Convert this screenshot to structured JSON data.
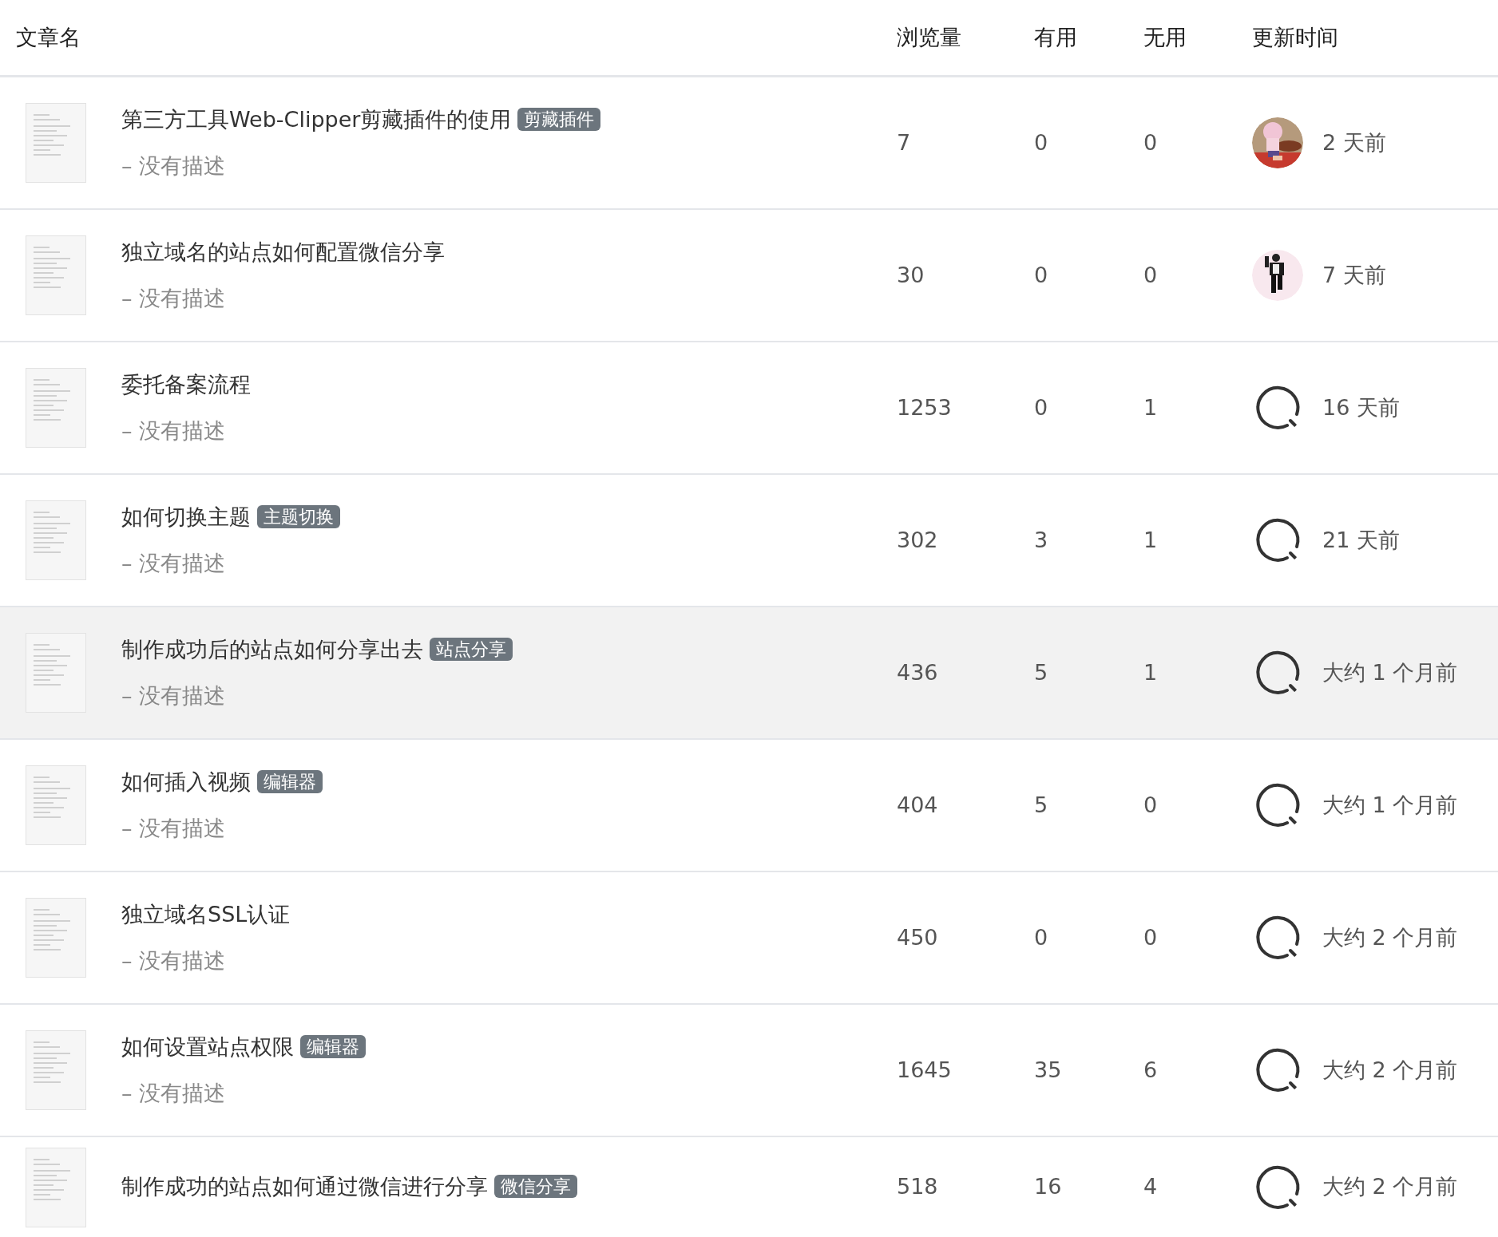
{
  "table": {
    "columns": [
      "文章名",
      "浏览量",
      "有用",
      "无用",
      "更新时间"
    ],
    "rows": [
      {
        "title": "第三方工具Web-Clipper剪藏插件的使用",
        "tag": "剪藏插件",
        "description": "– 没有描述",
        "views": "7",
        "useful": "0",
        "useless": "0",
        "updated": "2 天前",
        "hovered": false
      },
      {
        "title": "独立域名的站点如何配置微信分享",
        "description": "– 没有描述",
        "views": "30",
        "useful": "0",
        "useless": "0",
        "updated": "7 天前",
        "hovered": false
      },
      {
        "title": "委托备案流程",
        "description": "– 没有描述",
        "views": "1253",
        "useful": "0",
        "useless": "1",
        "avatar": {
          "kind": "default"
        },
        "updated": "16 天前",
        "hovered": false
      },
      {
        "title": "如何切换主题",
        "tag": "主题切换",
        "description": "– 没有描述",
        "views": "302",
        "useful": "3",
        "useless": "1",
        "avatar": {
          "kind": "default"
        },
        "updated": "21 天前",
        "hovered": false
      },
      {
        "title": "制作成功后的站点如何分享出去",
        "tag": "站点分享",
        "description": "– 没有描述",
        "views": "436",
        "useful": "5",
        "useless": "1",
        "avatar": {
          "kind": "default"
        },
        "updated": "大约 1 个月前",
        "hovered": true
      },
      {
        "title": "如何插入视频",
        "tag": "编辑器",
        "description": "– 没有描述",
        "views": "404",
        "useful": "5",
        "useless": "0",
        "avatar": {
          "kind": "default"
        },
        "updated": "大约 1 个月前",
        "hovered": false
      },
      {
        "title": "独立域名SSL认证",
        "description": "– 没有描述",
        "views": "450",
        "useful": "0",
        "useless": "0",
        "avatar": {
          "kind": "default"
        },
        "updated": "大约 2 个月前",
        "hovered": false
      },
      {
        "title": "如何设置站点权限",
        "tag": "编辑器",
        "description": "– 没有描述",
        "views": "1645",
        "useful": "35",
        "useless": "6",
        "avatar": {
          "kind": "default"
        },
        "updated": "大约 2 个月前",
        "hovered": false
      },
      {
        "title": "制作成功的站点如何通过微信进行分享",
        "tag": "微信分享",
        "views": "518",
        "useful": "16",
        "useless": "4",
        "avatar": {
          "kind": "default"
        },
        "updated": "大约 2 个月前",
        "hovered": false
      }
    ]
  }
}
